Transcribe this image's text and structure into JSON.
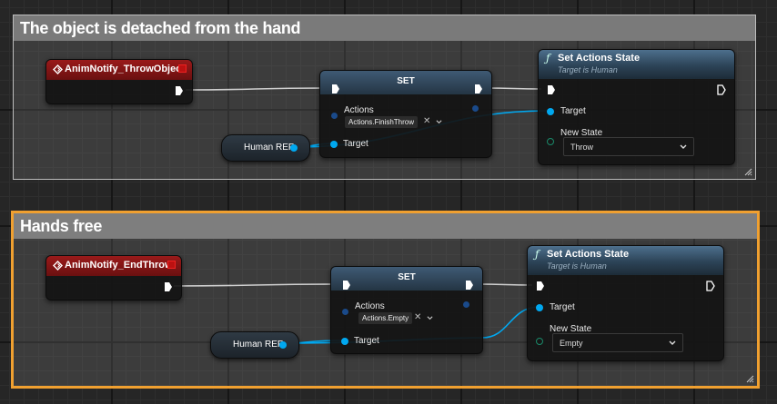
{
  "comments": [
    {
      "title": "The object is detached from the hand"
    },
    {
      "title": "Hands free"
    }
  ],
  "graph1": {
    "event": "AnimNotify_ThrowObject",
    "set": {
      "title": "SET",
      "actions_label": "Actions",
      "actions_value": "Actions.FinishThrow",
      "target_label": "Target"
    },
    "var": "Human REF",
    "func": {
      "title": "Set Actions State",
      "subtitle": "Target is Human",
      "target_label": "Target",
      "new_state_label": "New State",
      "new_state_value": "Throw"
    }
  },
  "graph2": {
    "event": "AnimNotify_EndThrow",
    "set": {
      "title": "SET",
      "actions_label": "Actions",
      "actions_value": "Actions.Empty",
      "target_label": "Target"
    },
    "var": "Human REF",
    "func": {
      "title": "Set Actions State",
      "subtitle": "Target is Human",
      "target_label": "Target",
      "new_state_label": "New State",
      "new_state_value": "Empty"
    }
  },
  "icons": {
    "function": "ƒ",
    "clear": "✕"
  },
  "colors": {
    "event_header": "#8a1616",
    "function_header": "#3f5f7a",
    "data_pin": "#00a8f0",
    "selection": "#f0a030"
  }
}
